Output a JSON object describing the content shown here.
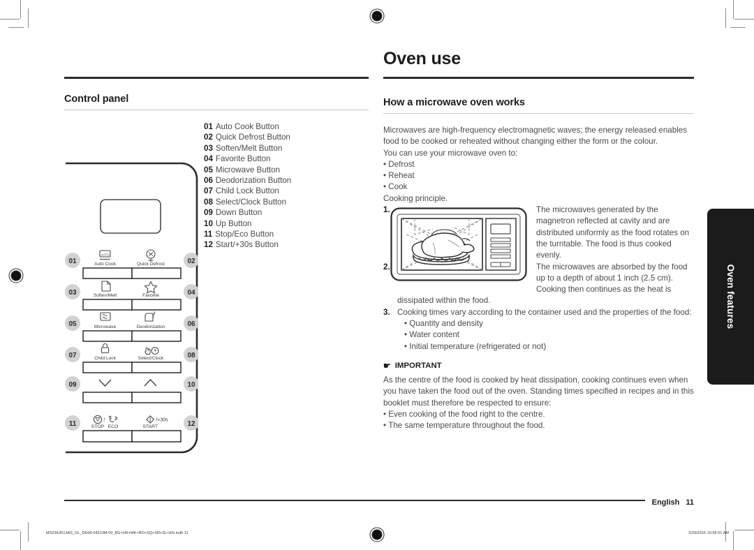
{
  "page": {
    "title": "Oven use",
    "side_tab_label": "Oven features",
    "footer_language": "English",
    "footer_page_number": "11",
    "imprint_left": "MS23K3513AS_OL_DE68-04313M-00_BG+HR+MK+RO+SQ+SR+SL+EN.indb   11",
    "imprint_right": "2/29/2016   10:58:51 AM"
  },
  "left_column": {
    "section_title": "Control panel",
    "control_items": [
      {
        "num": "01",
        "label": "Auto Cook Button"
      },
      {
        "num": "02",
        "label": "Quick Defrost Button"
      },
      {
        "num": "03",
        "label": "Soften/Melt Button"
      },
      {
        "num": "04",
        "label": "Favorite Button"
      },
      {
        "num": "05",
        "label": "Microwave Button"
      },
      {
        "num": "06",
        "label": "Deodorization Button"
      },
      {
        "num": "07",
        "label": "Child Lock Button"
      },
      {
        "num": "08",
        "label": "Select/Clock Button"
      },
      {
        "num": "09",
        "label": "Down Button"
      },
      {
        "num": "10",
        "label": "Up Button"
      },
      {
        "num": "11",
        "label": "Stop/Eco Button"
      },
      {
        "num": "12",
        "label": "Start/+30s Button"
      }
    ],
    "panel_art": {
      "badges": [
        "01",
        "02",
        "03",
        "04",
        "05",
        "06",
        "07",
        "08",
        "09",
        "10",
        "11",
        "12"
      ],
      "key_labels": {
        "auto_cook": "Auto Cook",
        "auto_icon_text": "AUTO",
        "quick_defrost": "Quick Defrost",
        "soften_melt": "Soften/Melt",
        "favorite": "Favorite",
        "microwave": "Microwave",
        "deodorization": "Deodorization",
        "child_lock": "Child Lock",
        "select_clock": "Select/Clock",
        "stop": "STOP",
        "eco": "ECO",
        "start": "START",
        "stop_eco_separator": "/",
        "start_plus30": "/+30s"
      }
    }
  },
  "right_column": {
    "section_title": "How a microwave oven works",
    "intro_paragraph": "Microwaves are high-frequency electromagnetic waves; the energy released enables food to be cooked or reheated without changing either the form or the colour.",
    "uses_lead": "You can use your microwave oven to:",
    "uses": [
      "Defrost",
      "Reheat",
      "Cook"
    ],
    "cooking_principle_lead": "Cooking principle.",
    "steps": [
      {
        "num": "1.",
        "text": "The microwaves generated by the magnetron reflected at cavity and are distributed uniformly as the food rotates on the turntable. The food is thus cooked evenly."
      },
      {
        "num": "2.",
        "text": "The microwaves are absorbed by the food up to a depth of about 1 inch (2.5 cm). Cooking then continues as the heat is dissipated within the food."
      },
      {
        "num": "3.",
        "text": "Cooking times vary according to the container used and the properties of the food:",
        "sub_bullets": [
          "Quantity and density",
          "Water content",
          "Initial temperature (refrigerated or not)"
        ]
      }
    ],
    "important": {
      "icon": "pointing-hand-icon",
      "heading": "IMPORTANT",
      "paragraph": "As the centre of the food is cooked by heat dissipation, cooking continues even when you have taken the food out of the oven. Standing times specified in recipes and in this booklet must therefore be respected to ensure:",
      "bullets": [
        "Even cooking of the food right to the centre.",
        "The same temperature throughout the food."
      ]
    }
  },
  "colors": {
    "ink": "#1d1d1d",
    "body": "#4a4a4a",
    "rule": "#2b2b2b",
    "tab_bg": "#1b1b1b",
    "badge_bg": "#d2d2d2"
  }
}
